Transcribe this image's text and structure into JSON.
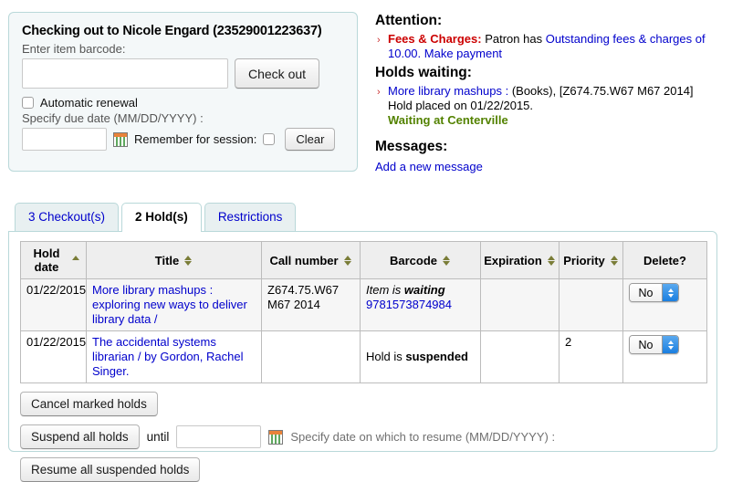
{
  "checkout_panel": {
    "title": "Checking out to Nicole Engard (23529001223637)",
    "barcode_label": "Enter item barcode:",
    "barcode_value": "",
    "checkout_button": "Check out",
    "auto_renewal_label": "Automatic renewal",
    "auto_renewal_checked": false,
    "due_date_label": "Specify due date (MM/DD/YYYY) :",
    "due_date_value": "",
    "calendar_icon": "calendar-icon",
    "remember_label": "Remember for session:",
    "remember_checked": false,
    "clear_button": "Clear"
  },
  "attention": {
    "heading": "Attention:",
    "fees_label": "Fees & Charges:",
    "fees_text_plain": " Patron has ",
    "fees_link": "Outstanding fees & charges of 10.00.",
    "fees_action_link": "Make payment",
    "holds_heading": "Holds waiting:",
    "hold_title_link": "More library mashups :",
    "hold_detail": " (Books), [Z674.75.W67 M67 2014]",
    "hold_placed": "Hold placed on 01/22/2015.",
    "hold_status": "Waiting at Centerville",
    "messages_heading": "Messages:",
    "add_message_link": "Add a new message",
    "colors": {
      "fees_red": "#cc0000",
      "link_blue": "#0000cc",
      "status_green": "#538200"
    }
  },
  "tabs": [
    {
      "label": "3 Checkout(s)",
      "active": false
    },
    {
      "label": "2 Hold(s)",
      "active": true
    },
    {
      "label": "Restrictions",
      "active": false
    }
  ],
  "holds_table": {
    "columns": [
      {
        "label": "Hold date",
        "sort": "asc"
      },
      {
        "label": "Title",
        "sort": "both"
      },
      {
        "label": "Call number",
        "sort": "both"
      },
      {
        "label": "Barcode",
        "sort": "both"
      },
      {
        "label": "Expiration",
        "sort": "both"
      },
      {
        "label": "Priority",
        "sort": "both"
      },
      {
        "label": "Delete?",
        "sort": "none"
      }
    ],
    "rows": [
      {
        "hold_date": "01/22/2015",
        "title": "More library mashups : exploring new ways to deliver library data /",
        "call_number": "Z674.75.W67 M67 2014",
        "barcode_status_prefix": "Item is ",
        "barcode_status_strong": "waiting",
        "barcode_number": "9781573874984",
        "expiration": "",
        "priority": "",
        "delete_value": "No"
      },
      {
        "hold_date": "01/22/2015",
        "title": "The accidental systems librarian / by Gordon, Rachel Singer.",
        "call_number": "",
        "barcode_status_prefix": "Hold is ",
        "barcode_status_strong": "suspended",
        "barcode_number": "",
        "expiration": "",
        "priority": "2",
        "delete_value": "No"
      }
    ]
  },
  "actions": {
    "cancel_marked_holds": "Cancel marked holds",
    "suspend_all_holds": "Suspend all holds",
    "until_label": "until",
    "suspend_date_value": "",
    "suspend_calendar_icon": "calendar-icon",
    "suspend_hint": "Specify date on which to resume (MM/DD/YYYY) :",
    "resume_all_suspended_holds": "Resume all suspended holds"
  }
}
